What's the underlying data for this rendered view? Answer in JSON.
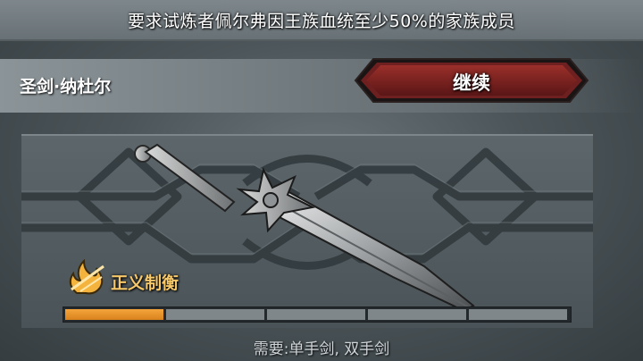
{
  "requirement": {
    "text": "要求试炼者佩尔弗因王族血统至少50%的家族成员"
  },
  "item": {
    "name": "圣剑·纳杜尔"
  },
  "continue_button": {
    "label": "继续"
  },
  "skill": {
    "name": "正义制衡",
    "icon": "flame-slash-icon"
  },
  "progress": {
    "filled_segments": 1,
    "total_segments": 5,
    "fill_color": "#f09a2e"
  },
  "requirement_weapons": {
    "text": "需要:单手剑, 双手剑"
  },
  "colors": {
    "accent": "#f6c86a",
    "button_red": "#7a1f1f",
    "background": "#4c5559"
  }
}
